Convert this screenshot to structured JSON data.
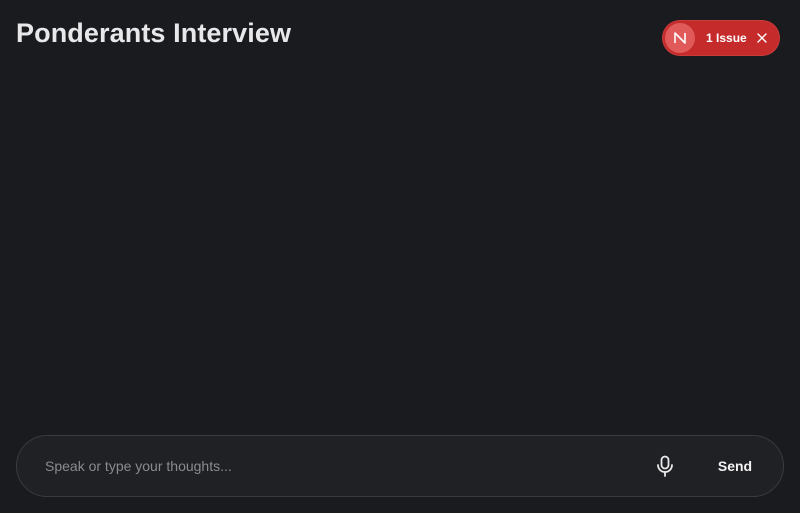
{
  "header": {
    "title": "Ponderants Interview"
  },
  "issue_badge": {
    "logo_letter": "N",
    "label": "1 Issue",
    "logo_icon": "nextjs-n-icon",
    "close_icon": "close-icon",
    "color": "#c52b2b"
  },
  "composer": {
    "placeholder": "Speak or type your thoughts...",
    "value": "",
    "mic_icon": "microphone-icon",
    "send_label": "Send"
  }
}
